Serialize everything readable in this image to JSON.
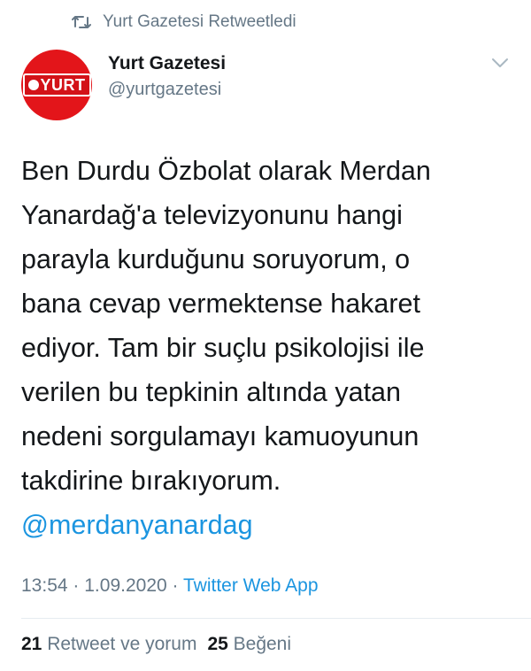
{
  "retweet": {
    "icon": "retweet-icon",
    "text": "Yurt Gazetesi Retweetledi"
  },
  "author": {
    "avatar_logo": "YURT",
    "name": "Yurt Gazetesi",
    "handle": "@yurtgazetesi"
  },
  "tweet": {
    "text": "Ben Durdu Özbolat olarak Merdan\nYanardağ'a televizyonunu hangi\nparayla kurduğunu soruyorum, o\nbana cevap vermektense hakaret\nediyor. Tam bir suçlu psikolojisi ile\nverilen bu tepkinin altında yatan\nnedeni sorgulamayı kamuoyunun\ntakdirine bırakıyorum.",
    "mention": "@merdanyanardag"
  },
  "meta": {
    "time": "13:54",
    "separator": "·",
    "date": "1.09.2020",
    "source": "Twitter Web App"
  },
  "stats": {
    "retweets_count": "21",
    "retweets_label": "Retweet ve yorum",
    "likes_count": "25",
    "likes_label": "Beğeni"
  },
  "colors": {
    "accent": "#1b95e0",
    "secondary_text": "#657786",
    "brand_red": "#e3151a"
  }
}
